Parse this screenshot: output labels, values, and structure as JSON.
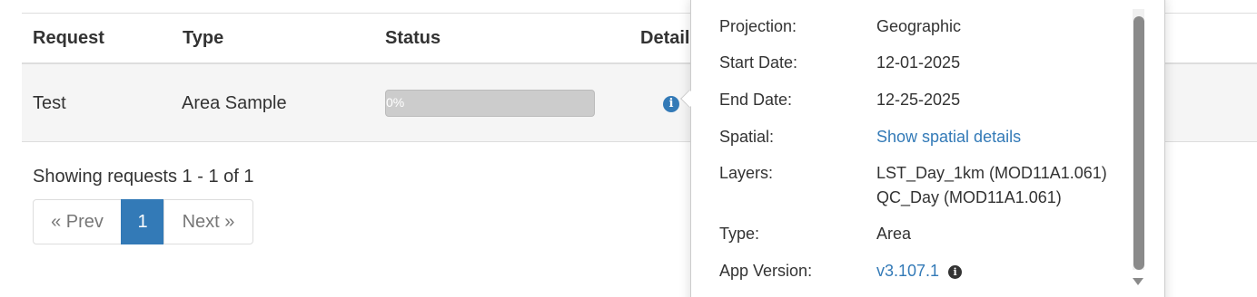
{
  "table": {
    "headers": [
      "Request",
      "Type",
      "Status",
      "Detail"
    ],
    "rows": [
      {
        "request": "Test",
        "type": "Area Sample",
        "progress_text": "0%",
        "progress_value": 0
      }
    ]
  },
  "details_icon": "info-circle-icon",
  "pagination": {
    "summary": "Showing requests 1 - 1 of 1",
    "prev": "« Prev",
    "current": "1",
    "next": "Next »"
  },
  "popover": {
    "fields": [
      {
        "label": "Projection:",
        "value": "Geographic"
      },
      {
        "label": "Start Date:",
        "value": "12-01-2025"
      },
      {
        "label": "End Date:",
        "value": "12-25-2025"
      },
      {
        "label": "Spatial:",
        "value": "Show spatial details"
      },
      {
        "label": "Layers:",
        "values": [
          "LST_Day_1km (MOD11A1.061)",
          "QC_Day (MOD11A1.061)"
        ]
      },
      {
        "label": "Type:",
        "value": "Area"
      },
      {
        "label": "App Version:",
        "value": "v3.107.1"
      }
    ]
  },
  "colors": {
    "primary": "#337ab7",
    "row_background": "#f5f5f5",
    "progress_track": "#cccccc",
    "scrollbar_thumb": "#8a8a8a"
  }
}
